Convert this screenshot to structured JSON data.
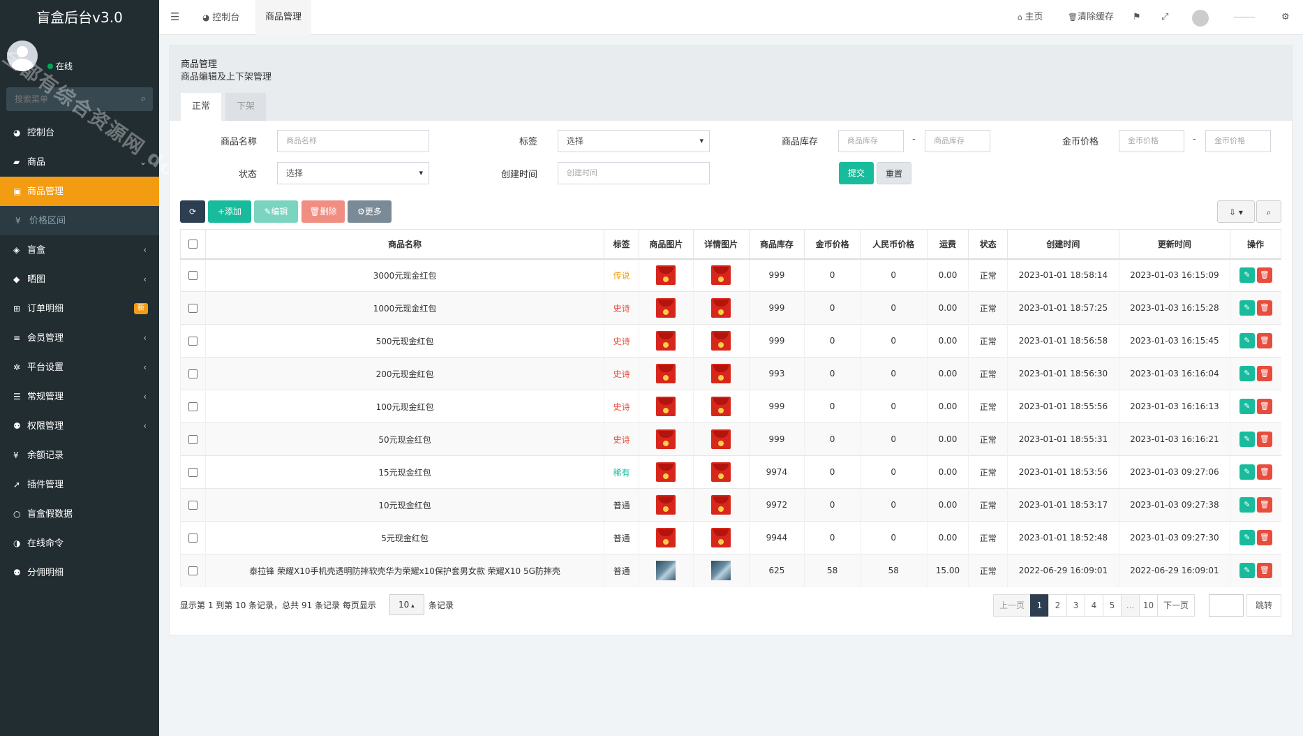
{
  "sidebar": {
    "brand": "盲盒后台v3.0",
    "status": "在线",
    "search_placeholder": "搜索菜单",
    "menu": [
      {
        "label": "控制台",
        "icon": "dashboard-icon",
        "glyph": "◕",
        "arrow": ""
      },
      {
        "label": "商品",
        "icon": "shopping-bag-icon",
        "glyph": "▰",
        "arrow": "⌄"
      },
      {
        "label": "商品管理",
        "icon": "gift-icon",
        "glyph": "▣",
        "arrow": "",
        "active": true
      },
      {
        "label": "价格区间",
        "icon": "yen-icon",
        "glyph": "¥",
        "arrow": "",
        "sub": true
      },
      {
        "label": "盲盒",
        "icon": "cube-icon",
        "glyph": "◈",
        "arrow": "‹"
      },
      {
        "label": "晒图",
        "icon": "diamond-icon",
        "glyph": "◆",
        "arrow": "‹"
      },
      {
        "label": "订单明细",
        "icon": "cart-icon",
        "glyph": "⊞",
        "arrow": "",
        "badge": "新"
      },
      {
        "label": "会员管理",
        "icon": "list-icon",
        "glyph": "≡",
        "arrow": "‹"
      },
      {
        "label": "平台设置",
        "icon": "gear-icon",
        "glyph": "✲",
        "arrow": "‹"
      },
      {
        "label": "常规管理",
        "icon": "database-icon",
        "glyph": "☰",
        "arrow": "‹"
      },
      {
        "label": "权限管理",
        "icon": "group-icon",
        "glyph": "⚉",
        "arrow": "‹"
      },
      {
        "label": "余额记录",
        "icon": "yen-icon",
        "glyph": "¥",
        "arrow": ""
      },
      {
        "label": "插件管理",
        "icon": "rocket-icon",
        "glyph": "➚",
        "arrow": ""
      },
      {
        "label": "盲盒假数据",
        "icon": "circle-icon",
        "glyph": "○",
        "arrow": ""
      },
      {
        "label": "在线命令",
        "icon": "adjust-icon",
        "glyph": "◑",
        "arrow": ""
      },
      {
        "label": "分佣明细",
        "icon": "group-icon",
        "glyph": "⚉",
        "arrow": ""
      }
    ]
  },
  "header": {
    "tab_dashboard": "控制台",
    "tab_goods": "商品管理",
    "home": "主页",
    "clear_cache": "清除缓存"
  },
  "page": {
    "title": "商品管理",
    "subtitle": "商品编辑及上下架管理",
    "tab_normal": "正常",
    "tab_off": "下架"
  },
  "filters": {
    "name_label": "商品名称",
    "name_placeholder": "商品名称",
    "tag_label": "标签",
    "tag_value": "选择",
    "stock_label": "商品库存",
    "stock_placeholder": "商品库存",
    "coin_label": "金币价格",
    "coin_placeholder": "金币价格",
    "status_label": "状态",
    "status_value": "选择",
    "ctime_label": "创建时间",
    "ctime_placeholder": "创建时间",
    "submit": "提交",
    "reset": "重置"
  },
  "toolbar": {
    "add": "添加",
    "edit": "编辑",
    "delete": "删除",
    "more": "更多"
  },
  "table": {
    "headers": [
      "商品名称",
      "标签",
      "商品图片",
      "详情图片",
      "商品库存",
      "金币价格",
      "人民币价格",
      "运费",
      "状态",
      "创建时间",
      "更新时间",
      "操作"
    ],
    "rows": [
      {
        "name": "3000元现金红包",
        "tag": "传说",
        "tag_class": "tag-legend",
        "img": "red",
        "stock": "999",
        "coin": "0",
        "rmb": "0",
        "freight": "0.00",
        "status": "正常",
        "created": "2023-01-01 18:58:14",
        "updated": "2023-01-03 16:15:09"
      },
      {
        "name": "1000元现金红包",
        "tag": "史诗",
        "tag_class": "tag-epic",
        "img": "red",
        "stock": "999",
        "coin": "0",
        "rmb": "0",
        "freight": "0.00",
        "status": "正常",
        "created": "2023-01-01 18:57:25",
        "updated": "2023-01-03 16:15:28"
      },
      {
        "name": "500元现金红包",
        "tag": "史诗",
        "tag_class": "tag-epic",
        "img": "red",
        "stock": "999",
        "coin": "0",
        "rmb": "0",
        "freight": "0.00",
        "status": "正常",
        "created": "2023-01-01 18:56:58",
        "updated": "2023-01-03 16:15:45"
      },
      {
        "name": "200元现金红包",
        "tag": "史诗",
        "tag_class": "tag-epic",
        "img": "red",
        "stock": "993",
        "coin": "0",
        "rmb": "0",
        "freight": "0.00",
        "status": "正常",
        "created": "2023-01-01 18:56:30",
        "updated": "2023-01-03 16:16:04"
      },
      {
        "name": "100元现金红包",
        "tag": "史诗",
        "tag_class": "tag-epic",
        "img": "red",
        "stock": "999",
        "coin": "0",
        "rmb": "0",
        "freight": "0.00",
        "status": "正常",
        "created": "2023-01-01 18:55:56",
        "updated": "2023-01-03 16:16:13"
      },
      {
        "name": "50元现金红包",
        "tag": "史诗",
        "tag_class": "tag-epic",
        "img": "red",
        "stock": "999",
        "coin": "0",
        "rmb": "0",
        "freight": "0.00",
        "status": "正常",
        "created": "2023-01-01 18:55:31",
        "updated": "2023-01-03 16:16:21"
      },
      {
        "name": "15元现金红包",
        "tag": "稀有",
        "tag_class": "tag-rare",
        "img": "red",
        "stock": "9974",
        "coin": "0",
        "rmb": "0",
        "freight": "0.00",
        "status": "正常",
        "created": "2023-01-01 18:53:56",
        "updated": "2023-01-03 09:27:06"
      },
      {
        "name": "10元现金红包",
        "tag": "普通",
        "tag_class": "tag-normal",
        "img": "red",
        "stock": "9972",
        "coin": "0",
        "rmb": "0",
        "freight": "0.00",
        "status": "正常",
        "created": "2023-01-01 18:53:17",
        "updated": "2023-01-03 09:27:38"
      },
      {
        "name": "5元现金红包",
        "tag": "普通",
        "tag_class": "tag-normal",
        "img": "red",
        "stock": "9944",
        "coin": "0",
        "rmb": "0",
        "freight": "0.00",
        "status": "正常",
        "created": "2023-01-01 18:52:48",
        "updated": "2023-01-03 09:27:30"
      },
      {
        "name": "泰拉锋 荣耀X10手机壳透明防摔软壳华为荣耀x10保护套男女款 荣耀X10 5G防摔壳",
        "tag": "普通",
        "tag_class": "tag-normal",
        "img": "photo",
        "stock": "625",
        "coin": "58",
        "rmb": "58",
        "freight": "15.00",
        "status": "正常",
        "created": "2022-06-29 16:09:01",
        "updated": "2022-06-29 16:09:01"
      }
    ]
  },
  "pagination": {
    "info": "显示第 1 到第 10 条记录，总共 91 条记录 每页显示",
    "page_size": "10",
    "info_suffix": "条记录",
    "prev": "上一页",
    "pages": [
      "1",
      "2",
      "3",
      "4",
      "5",
      "...",
      "10"
    ],
    "next": "下一页",
    "jump": "跳转"
  },
  "watermark": "全都有综合资源网 douyouvip.com"
}
